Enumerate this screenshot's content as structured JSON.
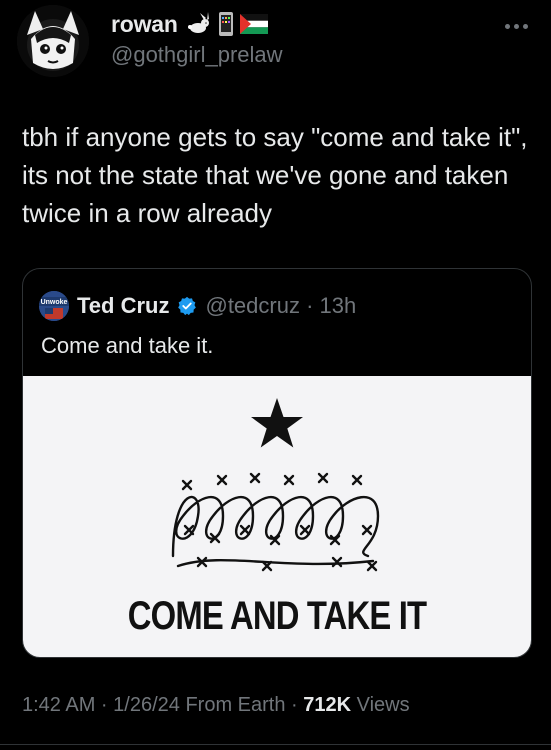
{
  "author": {
    "name": "rowan",
    "handle": "@gothgirl_prelaw",
    "badge_icons": [
      "rabbit-icon",
      "phone-icon",
      "flag-icon"
    ]
  },
  "tweet": {
    "text": "tbh if anyone gets to say \"come and take it\", its not the state that we've gone and taken twice in a row already"
  },
  "quoted_tweet": {
    "author_name": "Ted Cruz",
    "handle_time": "@tedcruz · 13h",
    "avatar_label": "Unwoke",
    "text": "Come and take it.",
    "image": {
      "caption": "COME AND TAKE IT",
      "icons": [
        "star-icon",
        "barbed-wire-icon"
      ]
    }
  },
  "meta": {
    "time_date": "1:42 AM · 1/26/24 From Earth · ",
    "views_count": "712K",
    "views_label": " Views"
  },
  "colors": {
    "background": "#000000",
    "text": "#e7e9ea",
    "secondary": "#71767b",
    "verified": "#1d9bf0",
    "border": "#2f3336"
  }
}
